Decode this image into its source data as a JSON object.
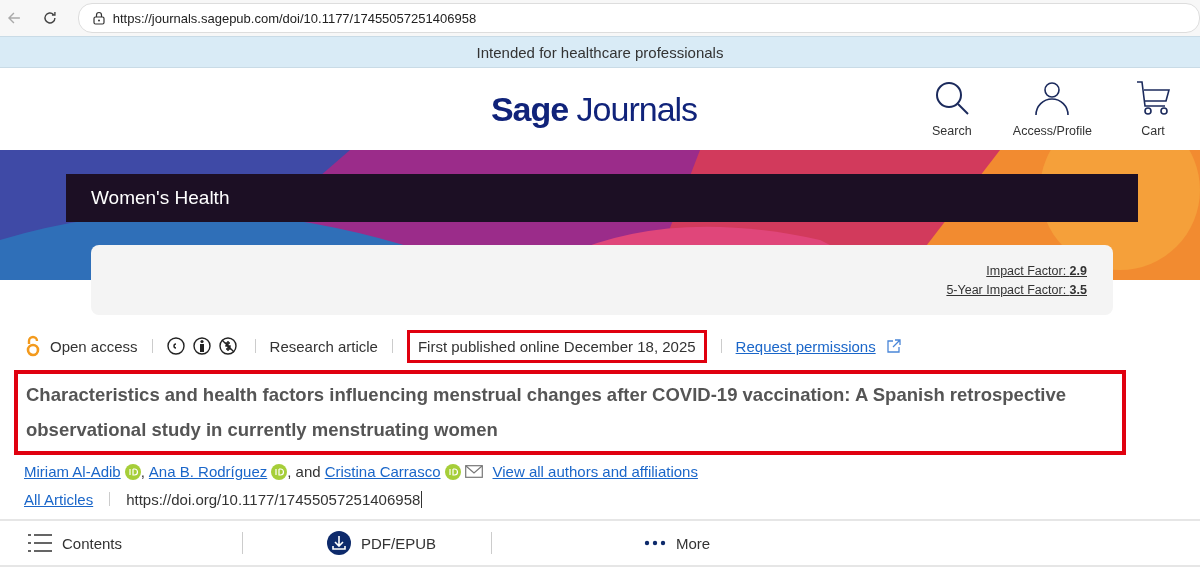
{
  "browser": {
    "url": "https://journals.sagepub.com/doi/10.1177/17455057251406958"
  },
  "notice": "Intended for healthcare professionals",
  "logo": {
    "brand": "Sage",
    "name": "Journals"
  },
  "header_actions": [
    {
      "kind": "search",
      "label": "Search"
    },
    {
      "kind": "profile",
      "label": "Access/Profile"
    },
    {
      "kind": "cart",
      "label": "Cart"
    }
  ],
  "journal": {
    "title": "Women's Health"
  },
  "metrics": [
    {
      "label": "Impact Factor:",
      "value": "2.9"
    },
    {
      "label": "5-Year Impact Factor:",
      "value": "3.5"
    }
  ],
  "meta": {
    "access": "Open access",
    "article_type": "Research article",
    "published": "First published online December 18, 2025",
    "published_highlighted": true,
    "permissions": "Request permissions"
  },
  "article": {
    "title": "Characteristics and health factors influencing menstrual changes after COVID-19 vaccination: A Spanish retrospective observational study in currently menstruating women",
    "highlighted": true
  },
  "authors": [
    {
      "name": "Miriam Al-Adib",
      "orcid": true,
      "email": false
    },
    {
      "separator": ",",
      "name": "Ana B. Rodríguez",
      "orcid": true,
      "email": false
    },
    {
      "separator": ", and",
      "name": "Cristina Carrasco",
      "orcid": true,
      "email": true
    }
  ],
  "all_authors_link": "View all authors and affiliations",
  "all_articles_link": "All Articles",
  "doi": "https://doi.org/10.1177/17455057251406958",
  "toolbar": [
    {
      "kind": "contents",
      "label": "Contents"
    },
    {
      "kind": "download",
      "label": "PDF/EPUB"
    },
    {
      "kind": "more",
      "label": "More"
    }
  ]
}
